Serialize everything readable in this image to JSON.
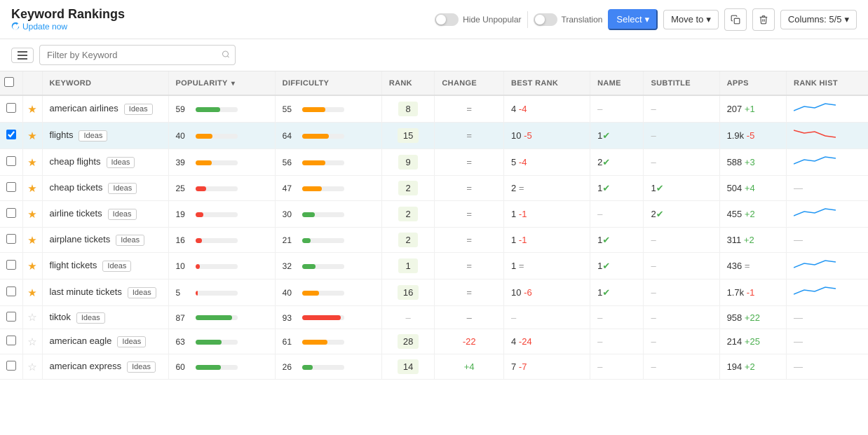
{
  "header": {
    "title": "Keyword Rankings",
    "update_label": "Update now",
    "hide_unpopular_label": "Hide Unpopular",
    "translation_label": "Translation",
    "select_label": "Select",
    "move_to_label": "Move to",
    "columns_label": "Columns: 5/5"
  },
  "filter": {
    "placeholder": "Filter by Keyword"
  },
  "columns": {
    "popularity": "POPULARITY",
    "difficulty": "DIFFICULTY",
    "rank": "RANK",
    "change": "CHANGE",
    "best_rank": "BEST RANK",
    "name": "NAME",
    "subtitle": "SUBTITLE",
    "apps": "APPS",
    "rank_hist": "RANK HIST"
  },
  "rows": [
    {
      "checked": false,
      "starred": true,
      "keyword": "american airlines",
      "ideas": "Ideas",
      "popularity": 59,
      "popularity_color": "green",
      "difficulty": 55,
      "difficulty_color": "orange",
      "rank": "8",
      "rank_has_bg": true,
      "change": "=",
      "change_type": "neutral",
      "best_rank": "4",
      "best_rank_neg": "-4",
      "name": "–",
      "subtitle": "–",
      "apps": "207",
      "apps_change": "+1",
      "apps_change_type": "pos",
      "sparkline": "up"
    },
    {
      "checked": true,
      "starred": true,
      "keyword": "flights",
      "ideas": "Ideas",
      "popularity": 40,
      "popularity_color": "orange",
      "difficulty": 64,
      "difficulty_color": "orange",
      "rank": "15",
      "rank_has_bg": true,
      "change": "=",
      "change_type": "neutral",
      "best_rank": "10",
      "best_rank_neg": "-5",
      "name": "1",
      "name_check": true,
      "subtitle": "–",
      "apps": "1.9k",
      "apps_change": "-5",
      "apps_change_type": "neg",
      "sparkline": "down"
    },
    {
      "checked": false,
      "starred": true,
      "keyword": "cheap flights",
      "ideas": "Ideas",
      "popularity": 39,
      "popularity_color": "orange",
      "difficulty": 56,
      "difficulty_color": "orange",
      "rank": "9",
      "rank_has_bg": true,
      "change": "=",
      "change_type": "neutral",
      "best_rank": "5",
      "best_rank_neg": "-4",
      "name": "2",
      "name_check": true,
      "subtitle": "–",
      "apps": "588",
      "apps_change": "+3",
      "apps_change_type": "pos",
      "sparkline": "up"
    },
    {
      "checked": false,
      "starred": true,
      "keyword": "cheap tickets",
      "ideas": "Ideas",
      "popularity": 25,
      "popularity_color": "red",
      "difficulty": 47,
      "difficulty_color": "orange",
      "rank": "2",
      "rank_has_bg": true,
      "change": "=",
      "change_type": "neutral",
      "best_rank": "2",
      "best_rank_neg": "=",
      "name": "1",
      "name_check": true,
      "subtitle": "1",
      "subtitle_check": true,
      "apps": "504",
      "apps_change": "+4",
      "apps_change_type": "pos",
      "sparkline": "none"
    },
    {
      "checked": false,
      "starred": true,
      "keyword": "airline tickets",
      "ideas": "Ideas",
      "popularity": 19,
      "popularity_color": "red",
      "difficulty": 30,
      "difficulty_color": "green",
      "rank": "2",
      "rank_has_bg": true,
      "change": "=",
      "change_type": "neutral",
      "best_rank": "1",
      "best_rank_neg": "-1",
      "name": "–",
      "subtitle": "2",
      "subtitle_check": true,
      "apps": "455",
      "apps_change": "+2",
      "apps_change_type": "pos",
      "sparkline": "up"
    },
    {
      "checked": false,
      "starred": true,
      "keyword": "airplane tickets",
      "ideas": "Ideas",
      "popularity": 16,
      "popularity_color": "red",
      "difficulty": 21,
      "difficulty_color": "green",
      "rank": "2",
      "rank_has_bg": true,
      "change": "=",
      "change_type": "neutral",
      "best_rank": "1",
      "best_rank_neg": "-1",
      "name": "1",
      "name_check": true,
      "subtitle": "–",
      "apps": "311",
      "apps_change": "+2",
      "apps_change_type": "pos",
      "sparkline": "none"
    },
    {
      "checked": false,
      "starred": true,
      "keyword": "flight tickets",
      "ideas": "Ideas",
      "popularity": 10,
      "popularity_color": "red",
      "difficulty": 32,
      "difficulty_color": "green",
      "rank": "1",
      "rank_has_bg": true,
      "change": "=",
      "change_type": "neutral",
      "best_rank": "1",
      "best_rank_neg": "=",
      "name": "1",
      "name_check": true,
      "subtitle": "–",
      "apps": "436",
      "apps_change": "=",
      "apps_change_type": "neutral",
      "sparkline": "up"
    },
    {
      "checked": false,
      "starred": true,
      "keyword": "last minute tickets",
      "ideas": "Ideas",
      "popularity": 5,
      "popularity_color": "red",
      "difficulty": 40,
      "difficulty_color": "orange",
      "rank": "16",
      "rank_has_bg": true,
      "change": "=",
      "change_type": "neutral",
      "best_rank": "10",
      "best_rank_neg": "-6",
      "name": "1",
      "name_check": true,
      "subtitle": "–",
      "apps": "1.7k",
      "apps_change": "-1",
      "apps_change_type": "neg",
      "sparkline": "up"
    },
    {
      "checked": false,
      "starred": false,
      "keyword": "tiktok",
      "ideas": "Ideas",
      "popularity": 87,
      "popularity_color": "green",
      "difficulty": 93,
      "difficulty_color": "red",
      "rank": "–",
      "rank_has_bg": false,
      "change": "–",
      "change_type": "neutral",
      "best_rank": "–",
      "best_rank_neg": "",
      "name": "–",
      "subtitle": "–",
      "apps": "958",
      "apps_change": "+22",
      "apps_change_type": "pos",
      "sparkline": "none"
    },
    {
      "checked": false,
      "starred": false,
      "keyword": "american eagle",
      "ideas": "Ideas",
      "popularity": 63,
      "popularity_color": "green",
      "difficulty": 61,
      "difficulty_color": "orange",
      "rank": "28",
      "rank_has_bg": true,
      "change": "-22",
      "change_type": "neg",
      "best_rank": "4",
      "best_rank_neg": "-24",
      "name": "–",
      "subtitle": "–",
      "apps": "214",
      "apps_change": "+25",
      "apps_change_type": "pos",
      "sparkline": "none"
    },
    {
      "checked": false,
      "starred": false,
      "keyword": "american express",
      "ideas": "Ideas",
      "popularity": 60,
      "popularity_color": "green",
      "difficulty": 26,
      "difficulty_color": "green",
      "rank": "14",
      "rank_has_bg": true,
      "change": "+4",
      "change_type": "pos",
      "best_rank": "7",
      "best_rank_neg": "-7",
      "name": "–",
      "subtitle": "–",
      "apps": "194",
      "apps_change": "+2",
      "apps_change_type": "pos",
      "sparkline": "none"
    }
  ]
}
